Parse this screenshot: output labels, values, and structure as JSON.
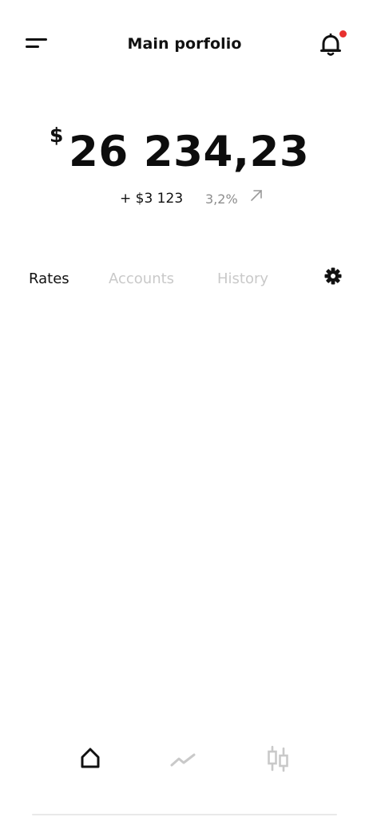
{
  "header": {
    "title": "Main porfolio",
    "menu_icon": "menu-icon",
    "notification_icon": "bell-icon",
    "notification_dot_color": "#e8312f"
  },
  "balance": {
    "currency_symbol": "$",
    "amount": "26 234,23",
    "change_amount": "+ $3 123",
    "change_percent": "3,2%",
    "trend_icon": "arrow-up-right-icon"
  },
  "tabs": [
    {
      "label": "Rates",
      "active": true
    },
    {
      "label": "Accounts",
      "active": false
    },
    {
      "label": "History",
      "active": false
    }
  ],
  "settings_icon": "gear-icon",
  "bottom_nav": {
    "items": [
      {
        "icon": "home-icon",
        "active": true
      },
      {
        "icon": "chart-line-icon",
        "active": false
      },
      {
        "icon": "candlestick-icon",
        "active": false
      }
    ],
    "active_color": "#111111",
    "inactive_color": "#c9c9c9"
  }
}
